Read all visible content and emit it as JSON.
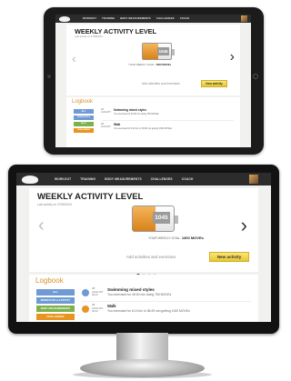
{
  "nav": {
    "items": [
      "WORKOUT",
      "TRAINING",
      "BODY MEASUREMENTS",
      "CHALLENGES",
      "COACH"
    ]
  },
  "activity": {
    "title": "WEEKLY ACTIVITY LEVEL",
    "subtitle": "Last activity on 27/08/2013",
    "battery_value": "1045",
    "goal_label": "YOUR WEEKLY GOAL:",
    "goal_value": "1300 MOVEs",
    "add_label": "Add activities and exercises",
    "new_button": "New activity",
    "fill_fraction": 0.8
  },
  "logbook": {
    "title": "Logbook",
    "filters": [
      "ALL",
      "WORKOUTS & ACTIVITY",
      "BODY MEASUREMENTS",
      "CHALLENGES"
    ],
    "entries": [
      {
        "day": "28",
        "month": "AUGUST",
        "year": "2013",
        "title": "Swimming mixed styles",
        "desc": "You exercised for 45:00 min doing 750 MOVEs"
      },
      {
        "day": "28",
        "month": "AUGUST",
        "year": "2013",
        "title": "Walk",
        "desc": "You exercised for 6:10 km in 38:49 min getting 1300 MOVEs"
      }
    ]
  },
  "colors": {
    "nav_bg": "#2c2c2c",
    "accent_orange": "#e8951f",
    "button_yellow": "#f3d451",
    "filter_blue": "#6f9ad4",
    "filter_orange": "#e8951f",
    "filter_green": "#7bb24a"
  },
  "icons": [
    "cloud-logo-icon",
    "chevron-left-icon",
    "chevron-right-icon",
    "battery-icon",
    "activity-icon",
    "swim-icon",
    "walk-icon"
  ]
}
